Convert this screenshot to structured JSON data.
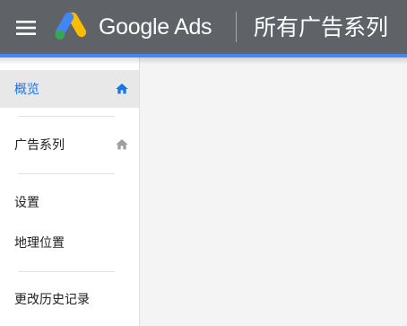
{
  "header": {
    "menu_icon": "hamburger-menu-icon",
    "logo_icon": "google-ads-logo-icon",
    "brand_name": "Google Ads",
    "page_title": "所有广告系列",
    "colors": {
      "background": "#5f6368",
      "accent": "#4285f4",
      "logo_blue": "#4285f4",
      "logo_yellow": "#fbbc04",
      "logo_green": "#34a853"
    }
  },
  "sidebar": {
    "items": [
      {
        "label": "概览",
        "icon": "home-icon",
        "active": true
      },
      {
        "label": "广告系列",
        "icon": "home-icon",
        "active": false
      },
      {
        "label": "设置",
        "active": false
      },
      {
        "label": "地理位置",
        "active": false
      },
      {
        "label": "更改历史记录",
        "active": false
      }
    ],
    "active_color": "#1a73e8"
  }
}
